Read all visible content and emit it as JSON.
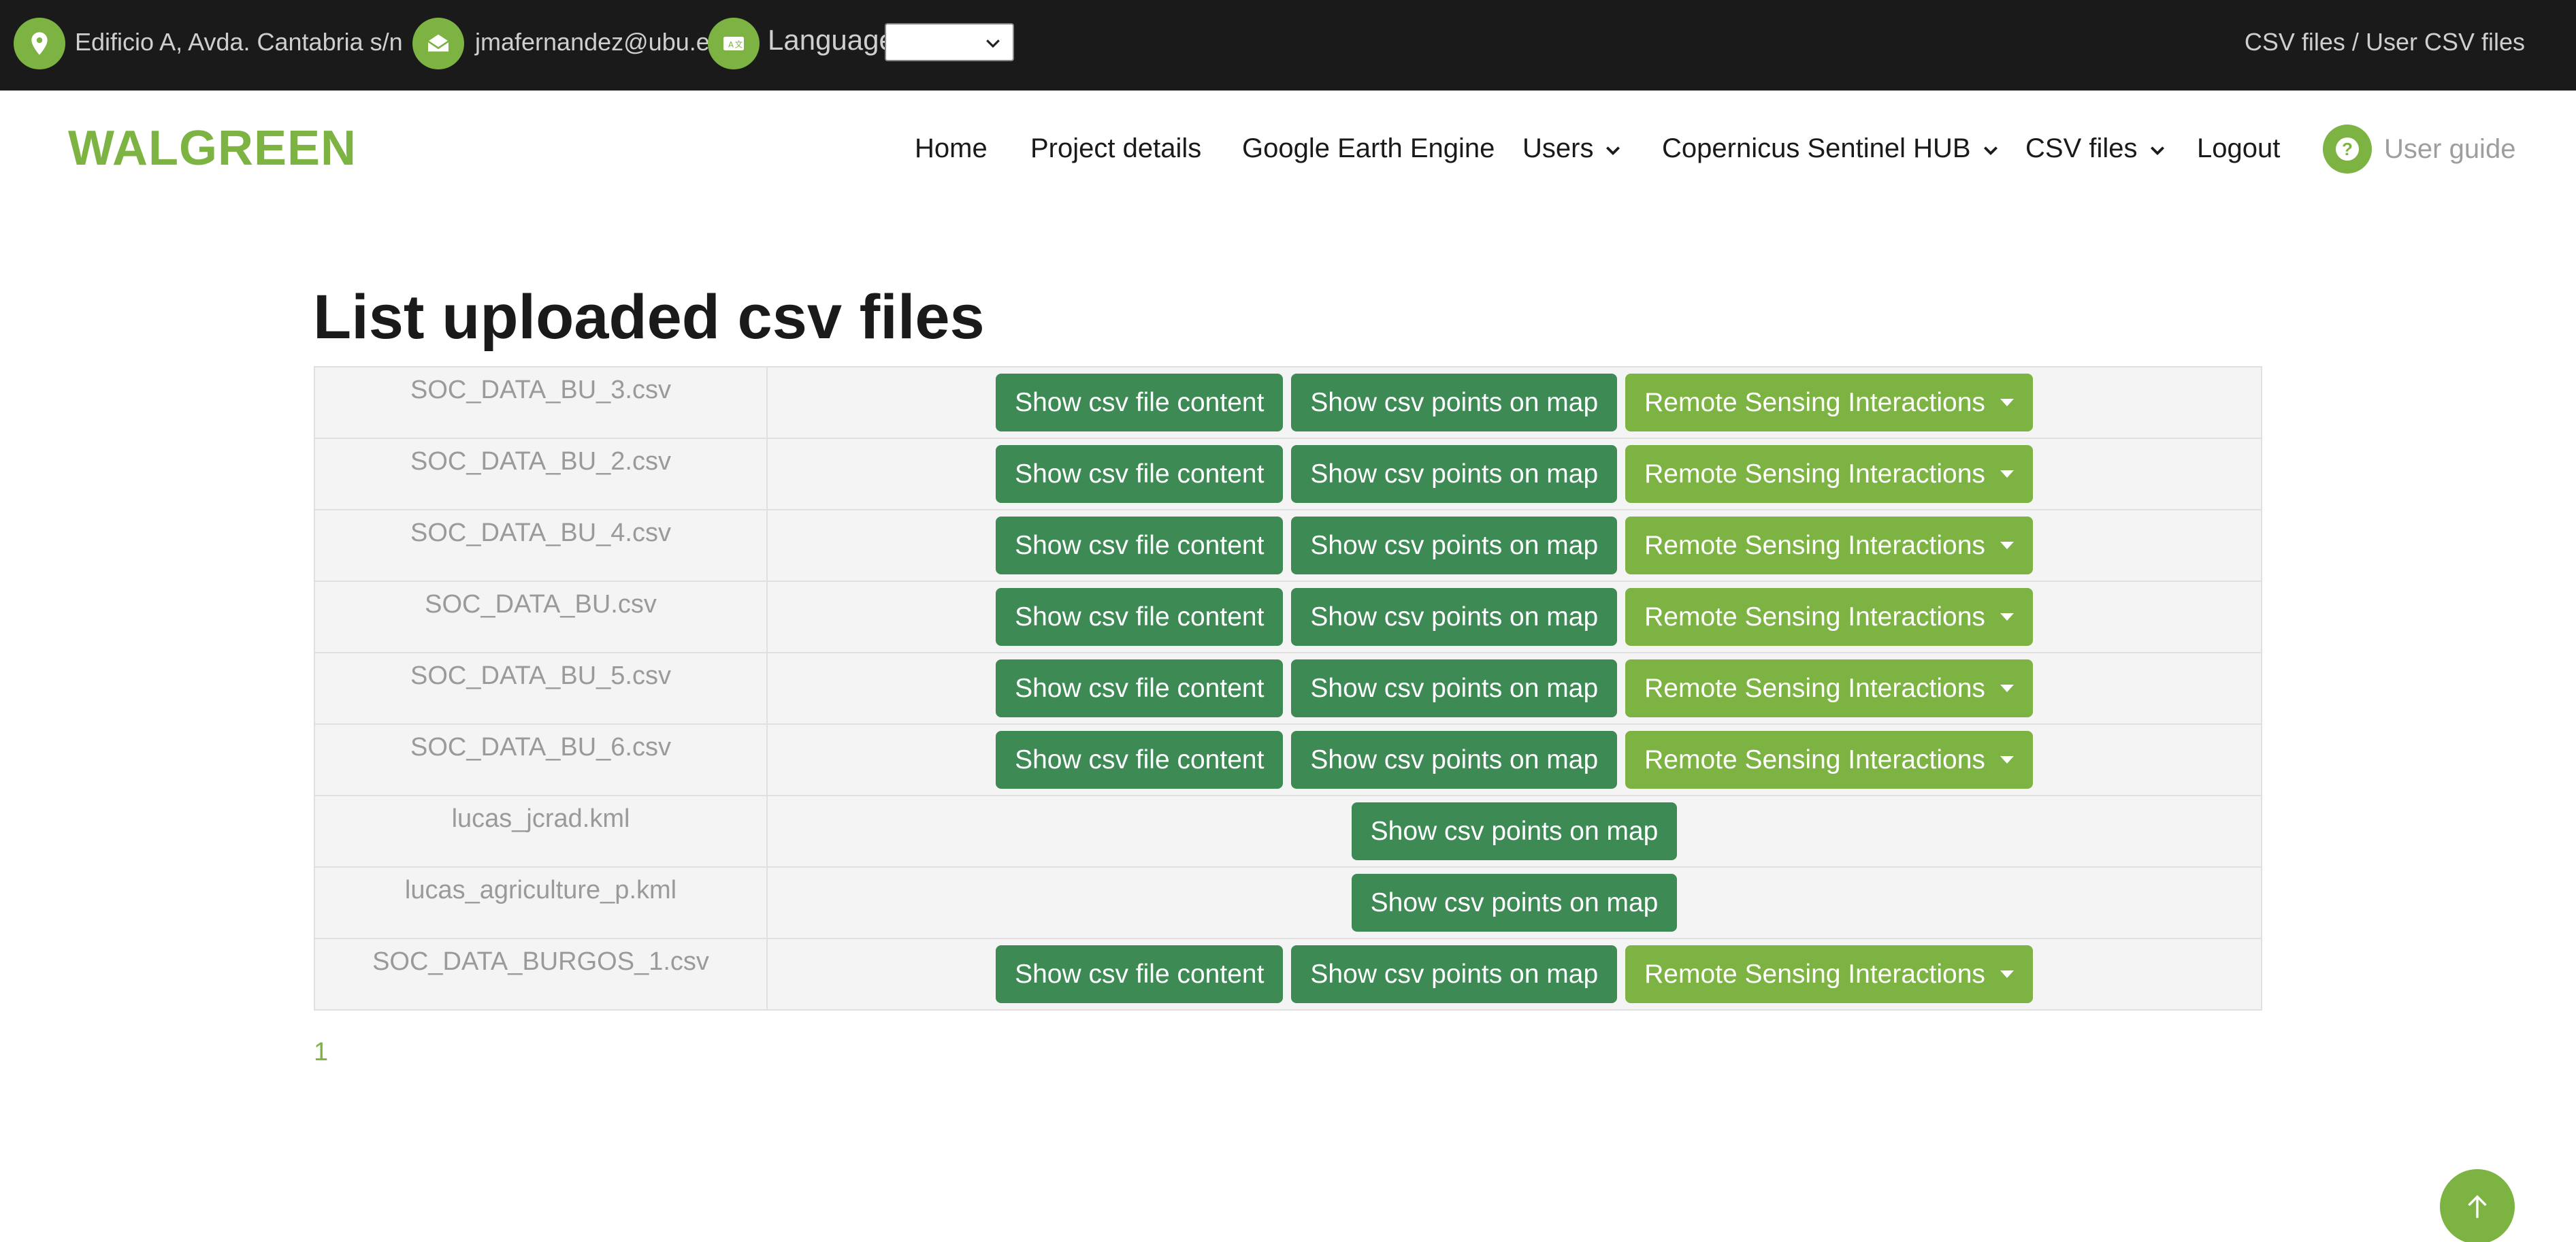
{
  "topbar": {
    "address": "Edificio A, Avda. Cantabria s/n",
    "email": "jmafernandez@ubu.es",
    "language_label": "Language:",
    "language_value": "",
    "breadcrumb": "CSV files / User CSV files",
    "icons": [
      "location-pin-icon",
      "envelope-icon",
      "translate-icon"
    ]
  },
  "nav": {
    "logo": "WALGREEN",
    "items": [
      {
        "label": "Home",
        "dropdown": false
      },
      {
        "label": "Project details",
        "dropdown": false
      },
      {
        "label": "Google Earth Engine",
        "dropdown": false
      },
      {
        "label": "Users",
        "dropdown": true
      },
      {
        "label": "Copernicus Sentinel HUB",
        "dropdown": true
      },
      {
        "label": "CSV files",
        "dropdown": true
      },
      {
        "label": "Logout",
        "dropdown": false
      }
    ],
    "user_guide": "User guide"
  },
  "page": {
    "title": "List uploaded csv files"
  },
  "buttons": {
    "show_content": "Show csv file content",
    "show_map": "Show csv points on map",
    "remote": "Remote Sensing Interactions"
  },
  "files": [
    {
      "name": "SOC_DATA_BU_3.csv",
      "full": true
    },
    {
      "name": "SOC_DATA_BU_2.csv",
      "full": true
    },
    {
      "name": "SOC_DATA_BU_4.csv",
      "full": true
    },
    {
      "name": "SOC_DATA_BU.csv",
      "full": true
    },
    {
      "name": "SOC_DATA_BU_5.csv",
      "full": true
    },
    {
      "name": "SOC_DATA_BU_6.csv",
      "full": true
    },
    {
      "name": "lucas_jcrad.kml",
      "full": false
    },
    {
      "name": "lucas_agriculture_p.kml",
      "full": false
    },
    {
      "name": "SOC_DATA_BURGOS_1.csv",
      "full": true
    }
  ],
  "pagination": {
    "current_page": "1"
  },
  "colors": {
    "accent_green": "#7cb342",
    "dark_green": "#3d8a55",
    "topbar_bg": "#1a1a1a"
  }
}
